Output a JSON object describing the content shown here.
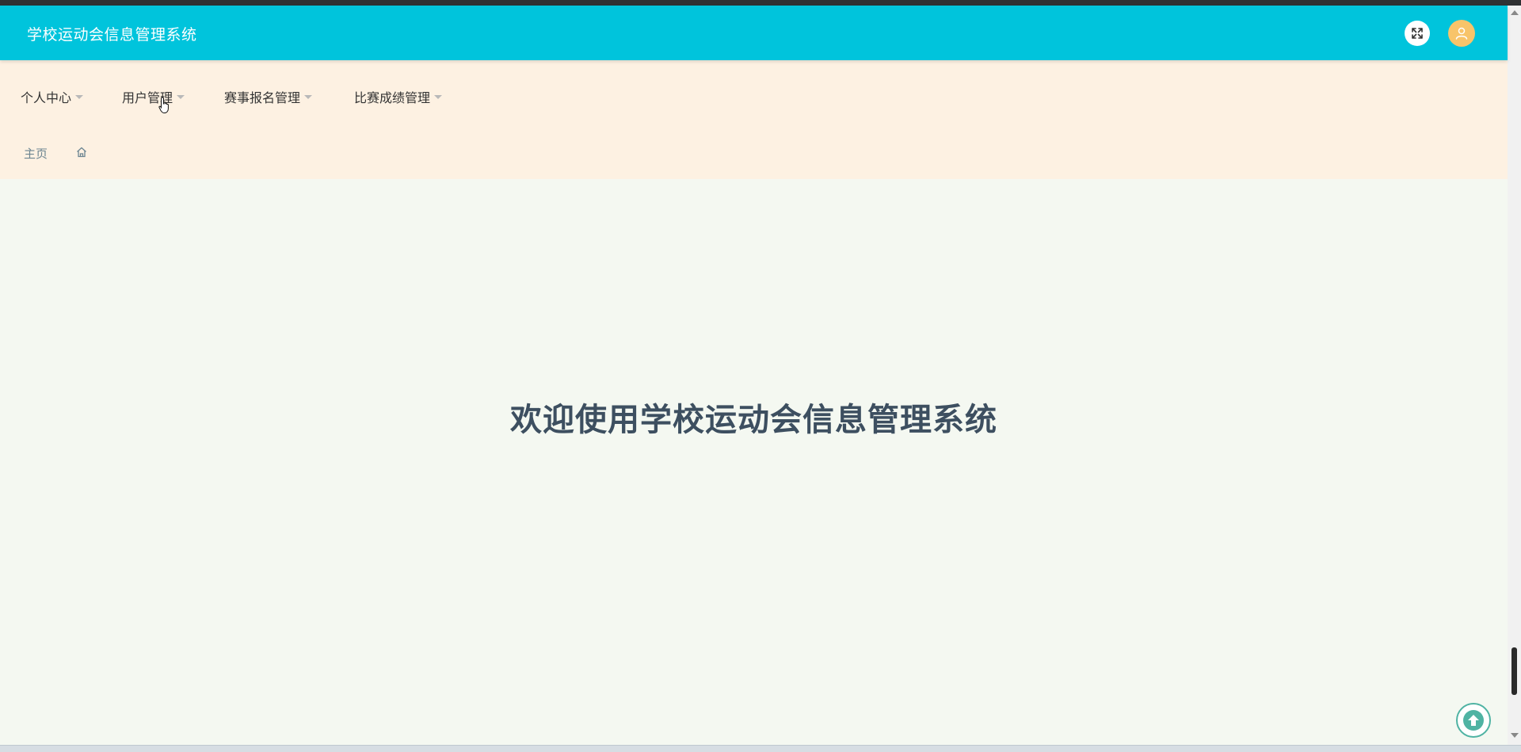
{
  "header": {
    "app_title": "学校运动会信息管理系统",
    "fullscreen_icon": "expand-arrows-icon",
    "avatar_icon": "user-avatar-icon",
    "header_color": "#00c4dc"
  },
  "menu": {
    "items": [
      {
        "label": "个人中心"
      },
      {
        "label": "用户管理"
      },
      {
        "label": "赛事报名管理"
      },
      {
        "label": "比赛成绩管理"
      }
    ]
  },
  "breadcrumb": {
    "home_label": "主页",
    "home_icon": "home-icon"
  },
  "main": {
    "welcome_text": "欢迎使用学校运动会信息管理系统"
  },
  "back_to_top": {
    "icon": "arrow-up-circle-icon",
    "accent": "#4fb3a3"
  }
}
